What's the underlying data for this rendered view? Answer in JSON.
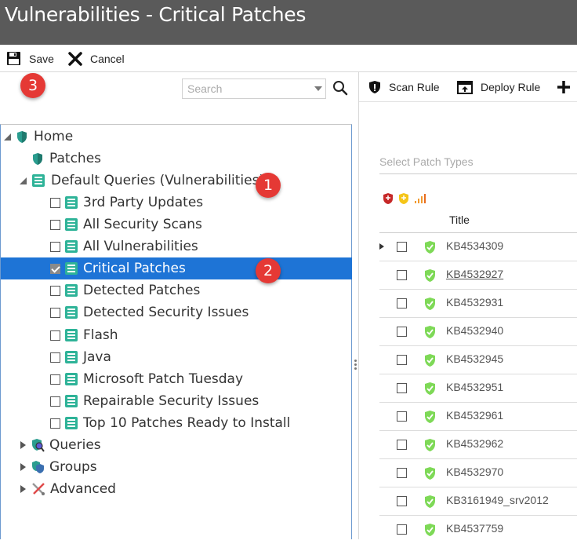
{
  "window": {
    "title": "Vulnerabilities - Critical Patches"
  },
  "toolbar": {
    "save_label": "Save",
    "cancel_label": "Cancel"
  },
  "search": {
    "placeholder": "Search"
  },
  "badges": {
    "b1": "1",
    "b2": "2",
    "b3": "3"
  },
  "tree": {
    "home": "Home",
    "patches": "Patches",
    "default_queries": "Default Queries (Vulnerabilities)",
    "items": [
      {
        "label": "3rd Party Updates",
        "checked": false
      },
      {
        "label": "All Security Scans",
        "checked": false
      },
      {
        "label": "All Vulnerabilities",
        "checked": false
      },
      {
        "label": "Critical Patches",
        "checked": true,
        "selected": true
      },
      {
        "label": "Detected Patches",
        "checked": false
      },
      {
        "label": "Detected Security Issues",
        "checked": false
      },
      {
        "label": "Flash",
        "checked": false
      },
      {
        "label": "Java",
        "checked": false
      },
      {
        "label": "Microsoft Patch Tuesday",
        "checked": false
      },
      {
        "label": "Repairable Security Issues",
        "checked": false
      },
      {
        "label": "Top 10 Patches Ready to Install",
        "checked": false
      }
    ],
    "queries": "Queries",
    "groups": "Groups",
    "advanced": "Advanced"
  },
  "right": {
    "scan_rule": "Scan Rule",
    "deploy_rule": "Deploy Rule",
    "patch_types_placeholder": "Select Patch Types",
    "title_header": "Title",
    "rows": [
      {
        "kb": "KB4534309",
        "expandable": true
      },
      {
        "kb": "KB4532927",
        "underlined": true
      },
      {
        "kb": "KB4532931"
      },
      {
        "kb": "KB4532940"
      },
      {
        "kb": "KB4532945"
      },
      {
        "kb": "KB4532951"
      },
      {
        "kb": "KB4532961"
      },
      {
        "kb": "KB4532962"
      },
      {
        "kb": "KB4532970"
      },
      {
        "kb": "KB3161949_srv2012"
      },
      {
        "kb": "KB4537759"
      }
    ]
  },
  "colors": {
    "selected": "#1e74d6",
    "titlebar": "#5a5a5a",
    "badge": "#e53935",
    "shield": "#7ed957",
    "query_icon": "#2eb398"
  }
}
